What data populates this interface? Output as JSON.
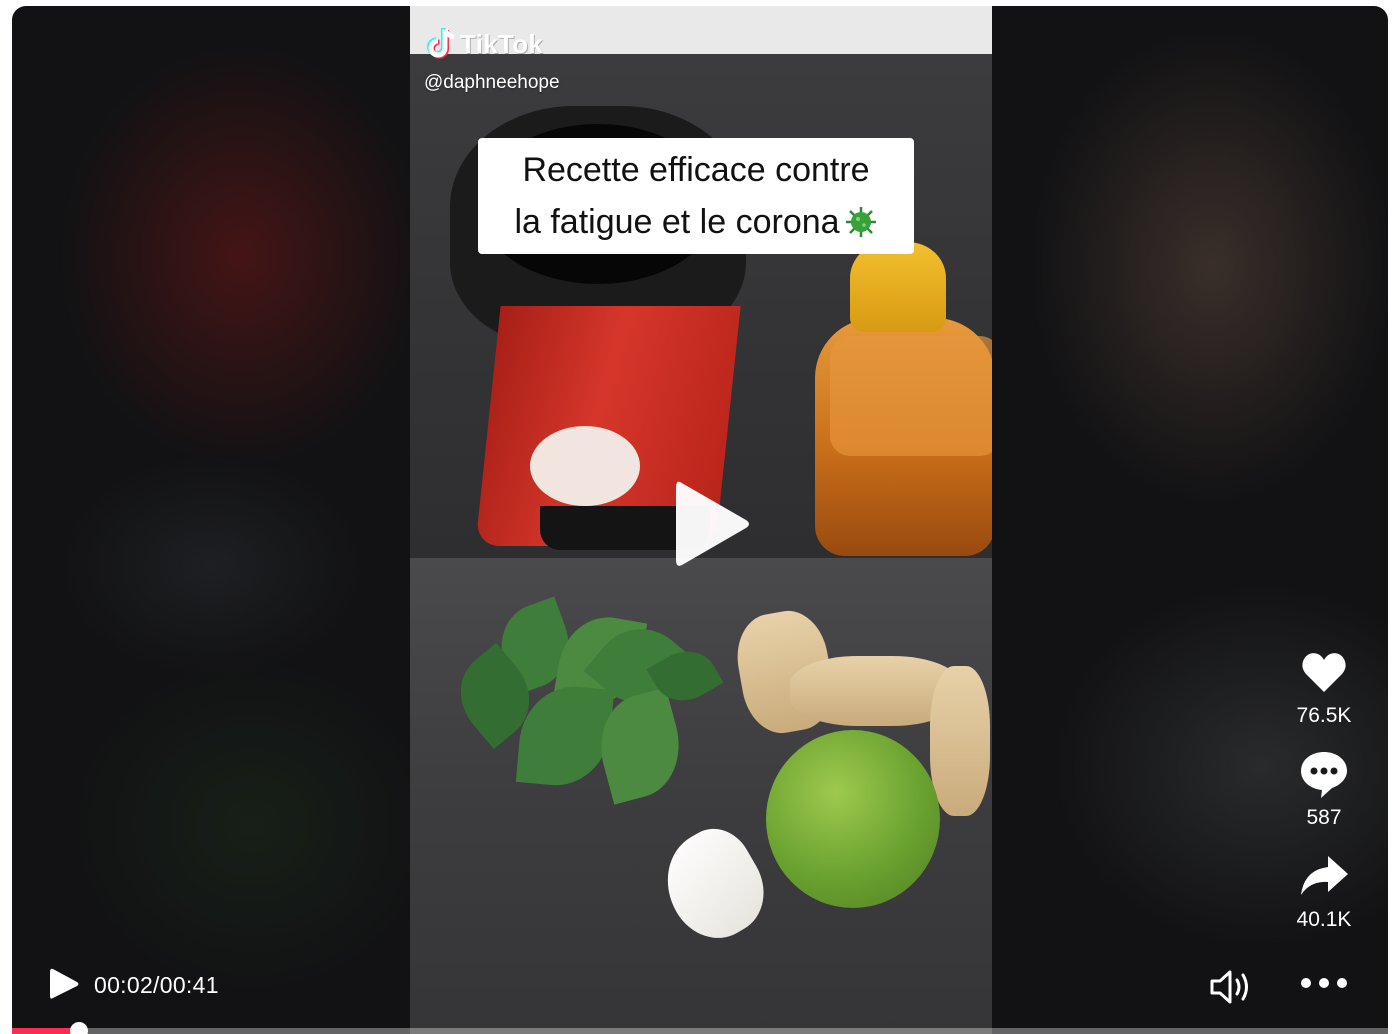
{
  "brand": {
    "logo_text": "TikTok",
    "handle": "@daphneehope"
  },
  "video": {
    "caption_line1": "Recette efficace contre",
    "caption_line2": "la fatigue et le corona",
    "caption_emoji": "virus-microbe",
    "play_icon": "play-icon"
  },
  "actions": {
    "likes": "76.5K",
    "comments": "587",
    "shares": "40.1K"
  },
  "controls": {
    "time": "00:02/00:41",
    "progress": 0.0488,
    "accent_color": "#fe2c55"
  }
}
